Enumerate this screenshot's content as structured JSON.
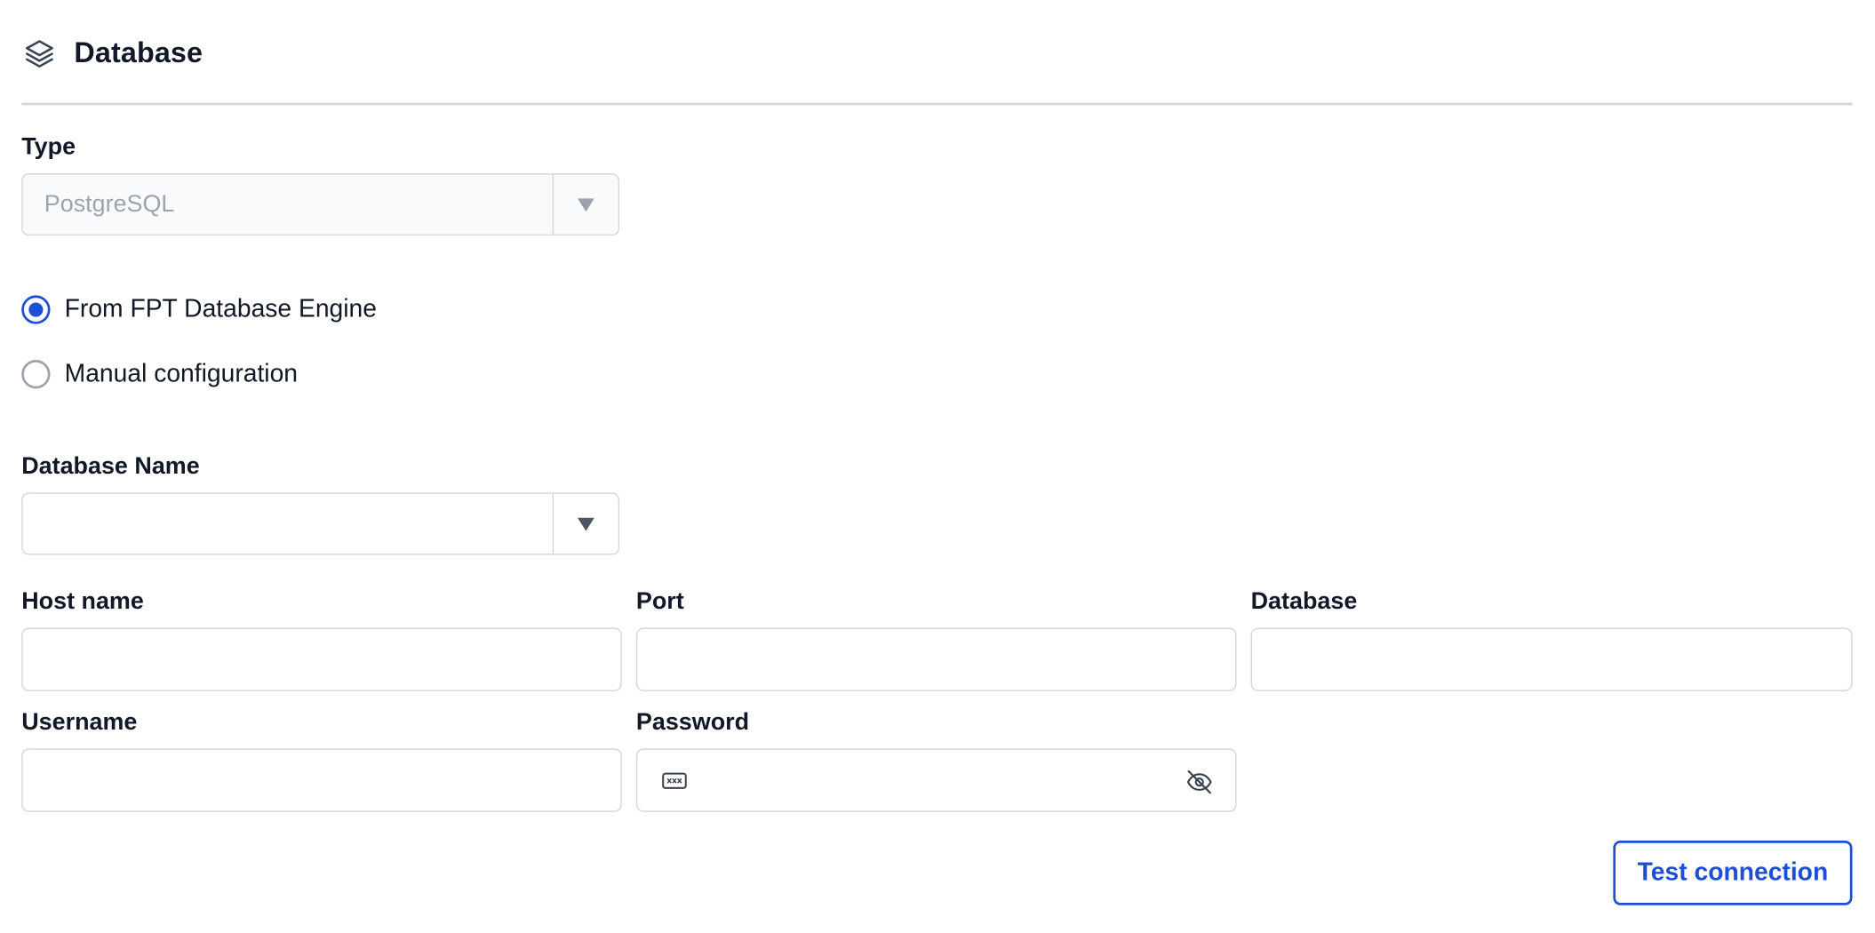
{
  "section": {
    "title": "Database",
    "icon": "layers-icon"
  },
  "type_field": {
    "label": "Type",
    "value": "PostgreSQL",
    "disabled": true
  },
  "source_options": [
    {
      "label": "From FPT Database Engine",
      "checked": true
    },
    {
      "label": "Manual configuration",
      "checked": false
    }
  ],
  "database_name_field": {
    "label": "Database Name",
    "value": ""
  },
  "fields": {
    "host_name": {
      "label": "Host name",
      "value": ""
    },
    "port": {
      "label": "Port",
      "value": ""
    },
    "database": {
      "label": "Database",
      "value": ""
    },
    "username": {
      "label": "Username",
      "value": ""
    },
    "password": {
      "label": "Password",
      "value": "",
      "leading_icon": "password-dots-icon",
      "trailing_icon": "eye-off-icon"
    }
  },
  "actions": {
    "test_connection_label": "Test connection"
  },
  "colors": {
    "accent": "#1d4ed8",
    "border": "#d1d5db",
    "text": "#111827",
    "muted": "#9ca3af"
  }
}
